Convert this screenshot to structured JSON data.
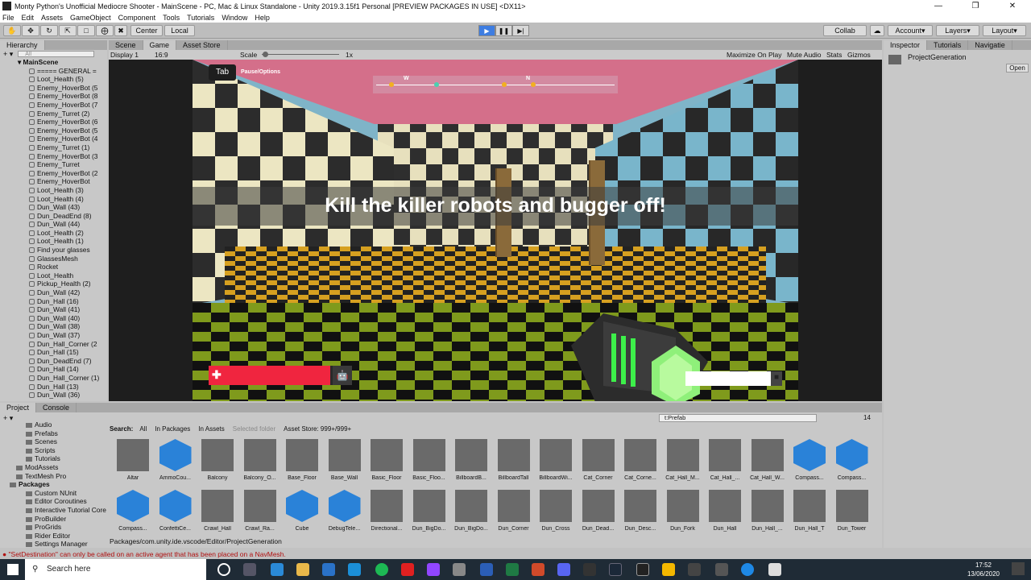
{
  "window": {
    "title": "Monty Python's Unofficial Mediocre Shooter - MainScene - PC, Mac & Linux Standalone - Unity 2019.3.15f1 Personal [PREVIEW PACKAGES IN USE] <DX11>"
  },
  "menu": [
    "File",
    "Edit",
    "Assets",
    "GameObject",
    "Component",
    "Tools",
    "Tutorials",
    "Window",
    "Help"
  ],
  "toolbar": {
    "center": "Center",
    "local": "Local",
    "collab": "Collab",
    "account": "Account",
    "layers": "Layers",
    "layout": "Layout"
  },
  "hierarchy": {
    "tab": "Hierarchy",
    "search_placeholder": "All",
    "scene": "MainScene",
    "items": [
      "===== GENERAL =",
      "Loot_Health (5)",
      "Enemy_HoverBot (5",
      "Enemy_HoverBot (8",
      "Enemy_HoverBot (7",
      "Enemy_Turret (2)",
      "Enemy_HoverBot (6",
      "Enemy_HoverBot (5",
      "Enemy_HoverBot (4",
      "Enemy_Turret (1)",
      "Enemy_HoverBot (3",
      "Enemy_Turret",
      "Enemy_HoverBot (2",
      "Enemy_HoverBot",
      "Loot_Health (3)",
      "Loot_Health (4)",
      "Dun_Wall (43)",
      "Dun_DeadEnd (8)",
      "Dun_Wall (44)",
      "Loot_Health (2)",
      "Loot_Health (1)",
      "Find your glasses",
      "GlassesMesh",
      "Rocket",
      "Loot_Health",
      "Pickup_Health (2)",
      "Dun_Wall (42)",
      "Dun_Hall (16)",
      "Dun_Wall (41)",
      "Dun_Wall (40)",
      "Dun_Wall (38)",
      "Dun_Wall (37)",
      "Dun_Hall_Corner (2",
      "Dun_Hall (15)",
      "Dun_DeadEnd (7)",
      "Dun_Hall (14)",
      "Dun_Hall_Corner (1)",
      "Dun_Hall (13)",
      "Dun_Wall (36)"
    ]
  },
  "center_tabs": [
    "Scene",
    "Game",
    "Asset Store"
  ],
  "game_bar": {
    "display": "Display 1",
    "aspect": "16:9",
    "scale_label": "Scale",
    "scale_value": "1x",
    "maximize": "Maximize On Play",
    "mute": "Mute Audio",
    "stats": "Stats",
    "gizmos": "Gizmos"
  },
  "game_hud": {
    "tab_key": "Tab",
    "pause_label": "Pause/Options",
    "banner": "Kill the killer robots and bugger off!",
    "compass_w": "W",
    "compass_n": "N",
    "health_level": 0.86,
    "ammo_level": 0.88
  },
  "inspector": {
    "tabs": [
      "Inspector",
      "Tutorials",
      "Navigatie"
    ],
    "object": "ProjectGeneration",
    "open_button": "Open"
  },
  "project": {
    "tabs": [
      "Project",
      "Console"
    ],
    "search_value": "t:Prefab",
    "count": "14",
    "filter_label": "Search:",
    "filters": [
      "All",
      "In Packages",
      "In Assets",
      "Selected folder",
      "Asset Store: 999+/999+"
    ],
    "tree": [
      "Audio",
      "Prefabs",
      "Scenes",
      "Scripts",
      "Tutorials",
      "ModAssets",
      "TextMesh Pro",
      "Packages",
      "Custom NUnit",
      "Editor Coroutines",
      "Interactive Tutorial Core",
      "ProBuilder",
      "ProGrids",
      "Rider Editor",
      "Settings Manager"
    ],
    "assets_row1": [
      "Altar",
      "AmmoCou...",
      "Balcony",
      "Balcony_O...",
      "Base_Floor",
      "Base_Wall",
      "Basic_Floor",
      "Basic_Floo...",
      "BillboardB...",
      "BillboardTall",
      "BillboardWi...",
      "Cat_Corner",
      "Cat_Corne...",
      "Cat_Hall_M...",
      "Cat_Hall_...",
      "Cat_Hall_W...",
      "Compass...",
      "Compass..."
    ],
    "assets_row2": [
      "Compass...",
      "ConfettiCe...",
      "Crawl_Hall",
      "Crawl_Ra...",
      "Cube",
      "DebugTele...",
      "Directional...",
      "Dun_BigDo...",
      "Dun_BigDo...",
      "Dun_Corner",
      "Dun_Cross",
      "Dun_Dead...",
      "Dun_Desc...",
      "Dun_Fork",
      "Dun_Hall",
      "Dun_Hall_...",
      "Dun_Hall_T",
      "Dun_Tower"
    ],
    "path": "Packages/com.unity.ide.vscode/Editor/ProjectGeneration"
  },
  "status": {
    "message": "\"SetDestination\" can only be called on an active agent that has been placed on a NavMesh."
  },
  "taskbar": {
    "search": "Search here",
    "time": "17:52",
    "date": "13/06/2020"
  }
}
